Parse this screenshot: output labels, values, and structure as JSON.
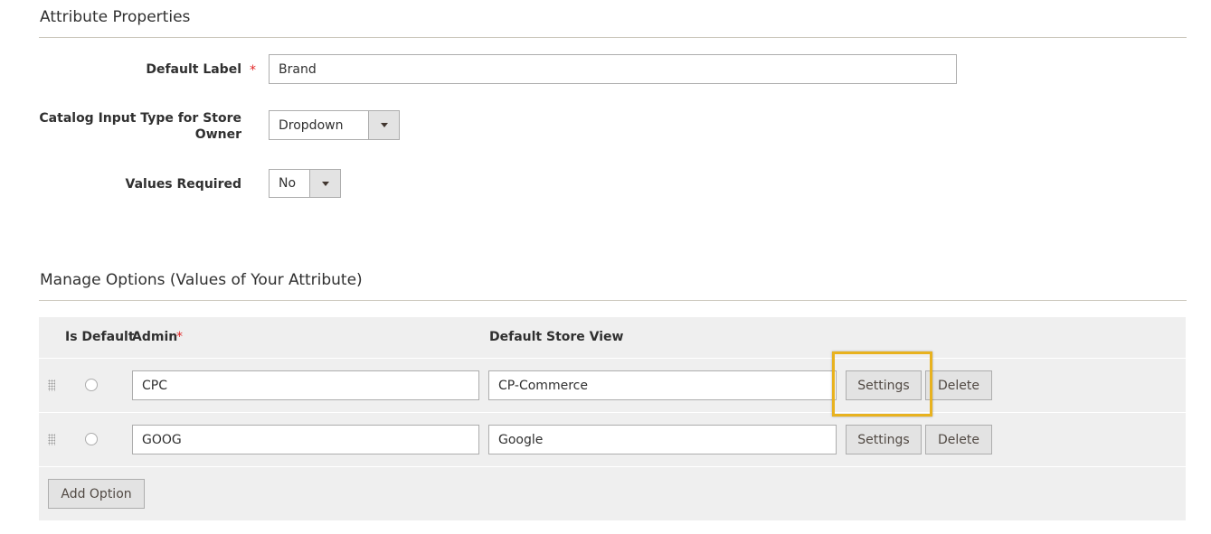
{
  "attribute_properties": {
    "title": "Attribute Properties",
    "default_label": {
      "label": "Default Label",
      "required_mark": "*",
      "value": "Brand"
    },
    "input_type": {
      "label_line1": "Catalog Input Type for Store",
      "label_line2": "Owner",
      "value": "Dropdown"
    },
    "values_required": {
      "label": "Values Required",
      "value": "No"
    }
  },
  "manage_options": {
    "title": "Manage Options (Values of Your Attribute)",
    "headers": {
      "is_default": "Is Default",
      "admin": "Admin",
      "admin_required_mark": "*",
      "store_view": "Default Store View"
    },
    "rows": [
      {
        "admin": "CPC",
        "store_view": "CP-Commerce",
        "settings_label": "Settings",
        "delete_label": "Delete"
      },
      {
        "admin": "GOOG",
        "store_view": "Google",
        "settings_label": "Settings",
        "delete_label": "Delete"
      }
    ],
    "add_option_label": "Add Option"
  },
  "colors": {
    "highlight": "#e8b21f",
    "required": "#e22626",
    "grid_background": "#efefef"
  }
}
